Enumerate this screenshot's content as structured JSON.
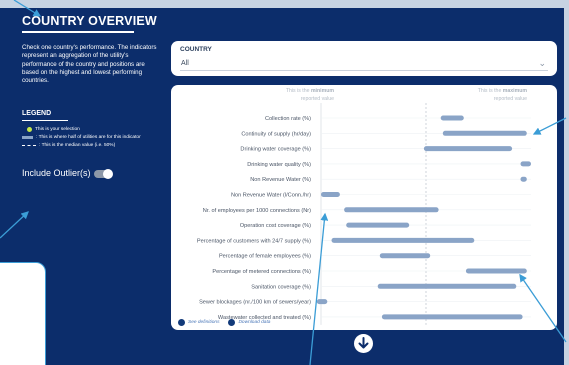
{
  "sidebar": {
    "title": "COUNTRY OVERVIEW",
    "description": "Check one country's performance. The indicators represent an aggregation of the utility's performance of the country and positions are based on the highest and lowest performing countries.",
    "legend_title": "LEGEND",
    "legend_items": [
      "This is your selection",
      ": This is where half of utilities are for this indicator",
      ": This is the median value (i.e. 50%)"
    ],
    "outlier_label": "Include Outlier(s)",
    "outlier_toggle_on": false
  },
  "country_filter": {
    "label": "COUNTRY",
    "value": "All"
  },
  "chart_header": {
    "min_prefix": "This is the ",
    "min_strong": "minimum",
    "min_suffix": "reported value",
    "max_prefix": "This is the ",
    "max_strong": "maximum",
    "max_suffix": "reported value"
  },
  "chart_data": {
    "type": "bar",
    "orientation": "horizontal-range",
    "scale": [
      0,
      1
    ],
    "median": 0.5,
    "categories": [
      "Collection rate (%)",
      "Continuity of supply (hr/day)",
      "Drinking water coverage (%)",
      "Drinking water quality (%)",
      "Non Revenue Water (%)",
      "Non Revenue Water (l/Conn./hr)",
      "Nr. of employees per 1000 connections (Nr)",
      "Operation cost coverage (%)",
      "Percentage of customers with 24/7 supply (%)",
      "Percentage of female employees (%)",
      "Percentage of metered connections (%)",
      "Sanitation coverage (%)",
      "Sewer blockages (nr./100 km of sewers/year)",
      "Wastewater collected and treated (%)"
    ],
    "ranges": [
      [
        0.57,
        0.68
      ],
      [
        0.58,
        0.98
      ],
      [
        0.49,
        0.91
      ],
      [
        0.95,
        1.0
      ],
      [
        0.95,
        0.98
      ],
      [
        0.0,
        0.09
      ],
      [
        0.11,
        0.56
      ],
      [
        0.12,
        0.42
      ],
      [
        0.05,
        0.73
      ],
      [
        0.28,
        0.52
      ],
      [
        0.69,
        0.98
      ],
      [
        0.27,
        0.93
      ],
      [
        -0.02,
        0.03
      ],
      [
        0.29,
        0.96
      ]
    ]
  },
  "footer": {
    "definitions_link": "See definitions",
    "download_link": "Download data"
  },
  "colors": {
    "background": "#0c2d6b",
    "bar": "#8aa4c7",
    "selection": "#c6e84b",
    "annotation": "#3b9dd6"
  }
}
